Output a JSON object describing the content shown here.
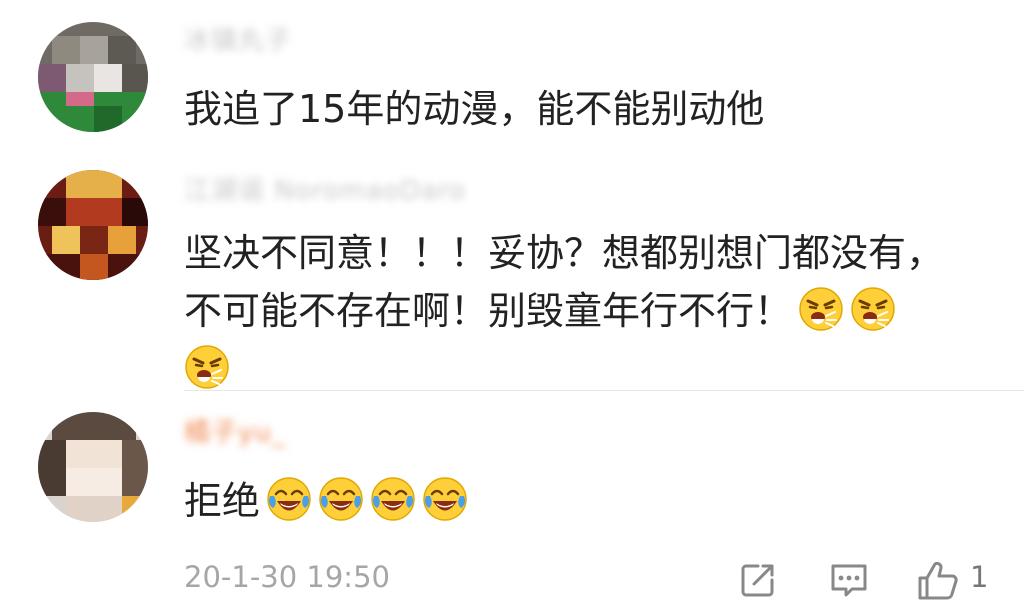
{
  "comments": [
    {
      "username": "冰镇丸子",
      "text_lines": [
        "我追了15年的动漫，能不能别动他"
      ],
      "emojis": []
    },
    {
      "username": "江湖谣 NoromaoDaro",
      "text_lines": [
        "坚决不同意！！！妥协？想都别想门都没有，",
        "不可能不存在啊！别毁童年行不行！"
      ],
      "emojis": [
        "angry-emoji",
        "angry-emoji",
        "angry-emoji"
      ]
    },
    {
      "username": "橘子yu_",
      "text_lines": [
        "拒绝"
      ],
      "emojis": [
        "laugh-cry-emoji",
        "laugh-cry-emoji",
        "laugh-cry-emoji",
        "laugh-cry-emoji"
      ]
    }
  ],
  "footer": {
    "timestamp": "20-1-30 19:50",
    "like_count": "1",
    "icons": [
      "share-icon",
      "comment-icon",
      "like-icon"
    ]
  },
  "colors": {
    "text": "#222222",
    "meta": "#a6a6a6",
    "icon": "#888888",
    "emoji_yellow": "#ffcf3a",
    "emoji_tear": "#4a9fe8"
  }
}
